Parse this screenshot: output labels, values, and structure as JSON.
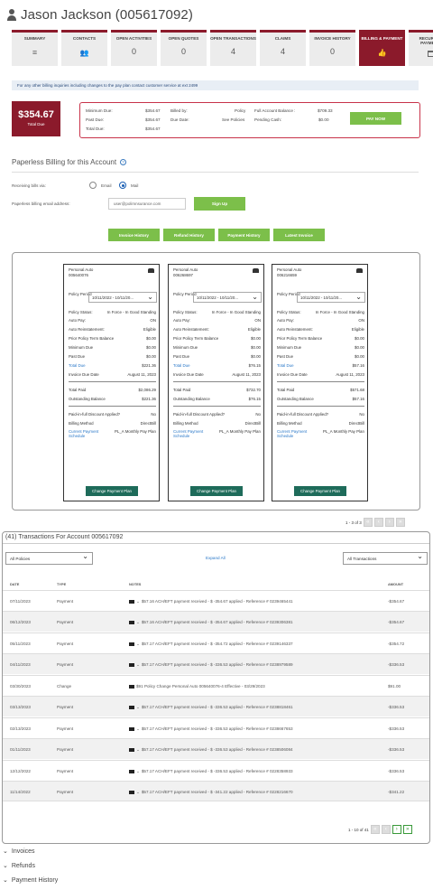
{
  "header": {
    "title": "Jason Jackson (005617092)"
  },
  "tabs": [
    {
      "label": "SUMMARY",
      "value": "",
      "icon": "menu-icon"
    },
    {
      "label": "CONTACTS",
      "value": "",
      "icon": "people-icon"
    },
    {
      "label": "OPEN ACTIVITIES",
      "value": "0"
    },
    {
      "label": "OPEN QUOTES",
      "value": "0"
    },
    {
      "label": "OPEN TRANSACTIONS",
      "value": "4"
    },
    {
      "label": "CLAIMS",
      "value": "4"
    },
    {
      "label": "INVOICE HISTORY",
      "value": "0"
    },
    {
      "label": "BILLING & PAYMENT",
      "value": "",
      "icon": "thumbs-up-icon"
    },
    {
      "label": "RECURRING PAYMENTS",
      "value": "",
      "icon": "credit-card-icon"
    }
  ],
  "info_bar": "For any other billing inquiries including changes to the pay plan contact customer service at ext 2499",
  "balance": {
    "amount": "$354.67",
    "label": "Total Due",
    "minimum_due_label": "Minimum Due:",
    "minimum_due": "$354.67",
    "past_due_label": "Past Due:",
    "past_due": "$354.67",
    "total_due_label": "Total Due:",
    "total_due": "$354.67",
    "billed_by_label": "Billed by:",
    "billed_by": "Policy",
    "due_date_label": "Due Date:",
    "due_date": "See Policies",
    "full_balance_label": "Full Account Balance :",
    "full_balance": "$709.33",
    "pending_cash_label": "Pending Cash:",
    "pending_cash": "$0.00",
    "pay_now": "PAY NOW"
  },
  "paperless": {
    "title": "Paperless Billing for this Account",
    "receiving_label": "Receiving bills via:",
    "opt_email": "Email",
    "opt_mail": "Mail",
    "email_label": "Paperless billing email address:",
    "email_value": "user@polimnsurance.com",
    "signup": "Sign Up"
  },
  "history_buttons": [
    "Invoice History",
    "Refund History",
    "Payment History",
    "Latest Invoice"
  ],
  "policies": [
    {
      "type": "Personal Auto",
      "number": "005640076",
      "policy_period_label": "Policy Period",
      "period": "10/11/2022 - 10/11/20...",
      "status_label": "Policy Status:",
      "status": "In Force - In Good Standing",
      "autopay_label": "Auto Pay:",
      "autopay": "ON",
      "reinstate_label": "Auto Reinstatement:",
      "reinstate": "Eligible",
      "prior_label": "Prior Policy Term Balance",
      "prior": "$0.00",
      "min_label": "Minimum Due",
      "min": "$0.00",
      "past_label": "Past Due",
      "past": "$0.00",
      "total_label": "Total Due",
      "total": "$221.36",
      "invdate_label": "Invoice Due Date",
      "invdate": "August 11, 2023",
      "paid_label": "Total Paid",
      "paid": "$2,086.29",
      "outst_label": "Outstanding Balance",
      "outst": "$221.36",
      "pif_label": "Paid-in-full Discount Applied?",
      "pif": "No",
      "method_label": "Billing Method",
      "method": "DirectBill",
      "schedule_label": "Current Payment Schedule",
      "schedule": "PL_A Monthly Pay Plan",
      "change_btn": "Change Payment Plan"
    },
    {
      "type": "Personal Auto",
      "number": "006268697",
      "policy_period_label": "Policy Period",
      "period": "10/11/2022 - 10/11/20...",
      "status_label": "Policy Status:",
      "status": "In Force - In Good Standing",
      "autopay_label": "Auto Pay:",
      "autopay": "ON",
      "reinstate_label": "Auto Reinstatement:",
      "reinstate": "Eligible",
      "prior_label": "Prior Policy Term Balance",
      "prior": "$0.00",
      "min_label": "Minimum Due",
      "min": "$0.00",
      "past_label": "Past Due",
      "past": "$0.00",
      "total_label": "Total Due",
      "total": "$76.15",
      "invdate_label": "Invoice Due Date",
      "invdate": "August 11, 2023",
      "paid_label": "Total Paid",
      "paid": "$732.70",
      "outst_label": "Outstanding Balance",
      "outst": "$76.15",
      "pif_label": "Paid-in-full Discount Applied?",
      "pif": "No",
      "method_label": "Billing Method",
      "method": "DirectBill",
      "schedule_label": "Current Payment Schedule",
      "schedule": "PL_A Monthly Pay Plan",
      "change_btn": "Change Payment Plan"
    },
    {
      "type": "Personal Auto",
      "number": "006216659",
      "policy_period_label": "Policy Period",
      "period": "10/11/2022 - 10/11/20...",
      "status_label": "Policy Status:",
      "status": "In Force - In Good Standing",
      "autopay_label": "Auto Pay:",
      "autopay": "ON",
      "reinstate_label": "Auto Reinstatement:",
      "reinstate": "Eligible",
      "prior_label": "Prior Policy Term Balance",
      "prior": "$0.00",
      "min_label": "Minimum Due",
      "min": "$0.00",
      "past_label": "Past Due",
      "past": "$0.00",
      "total_label": "Total Due",
      "total": "$57.16",
      "invdate_label": "Invoice Due Date",
      "invdate": "August 11, 2023",
      "paid_label": "Total Paid",
      "paid": "$571.68",
      "outst_label": "Outstanding Balance",
      "outst": "$57.16",
      "pif_label": "Paid-in-full Discount Applied?",
      "pif": "No",
      "method_label": "Billing Method",
      "method": "DirectBill",
      "schedule_label": "Current Payment Schedule",
      "schedule": "PL_A Monthly Pay Plan",
      "change_btn": "Change Payment Plan"
    }
  ],
  "policy_pager": "1 - 3 of 3",
  "transactions": {
    "title": "(41) Transactions For Account 005617092",
    "filter_policy": "All Policies",
    "expand_all": "Expand All",
    "filter_tx": "All Transactions",
    "col_date": "DATE",
    "col_type": "TYPE",
    "col_notes": "NOTES",
    "col_amount": "AMOUNT",
    "rows": [
      {
        "date": "07/11/2023",
        "type": "Payment",
        "notes": "$57.16 ACH/EFT payment received - $ -354.67 applied - Reference # 0239465441",
        "amount": "-$354.67"
      },
      {
        "date": "06/12/2023",
        "type": "Payment",
        "notes": "$57.16 ACH/EFT payment received - $ -354.67 applied - Reference # 0239306381",
        "amount": "-$354.67"
      },
      {
        "date": "05/11/2023",
        "type": "Payment",
        "notes": "$57.17 ACH/EFT payment received - $ -354.72 applied - Reference # 0239146337",
        "amount": "-$354.72"
      },
      {
        "date": "04/11/2023",
        "type": "Payment",
        "notes": "$57.17 ACH/EFT payment received - $ -336.53 applied - Reference # 0238979589",
        "amount": "-$336.53"
      },
      {
        "date": "03/30/2023",
        "type": "Change",
        "notes": "$91 Policy Change Personal Auto 005640076-4 Effective - 03/29/2023",
        "amount": "$91.00"
      },
      {
        "date": "03/13/2023",
        "type": "Payment",
        "notes": "$57.17 ACH/EFT payment received - $ -336.53 applied - Reference # 0238818461",
        "amount": "-$336.53"
      },
      {
        "date": "02/13/2023",
        "type": "Payment",
        "notes": "$57.17 ACH/EFT payment received - $ -336.53 applied - Reference # 0238667653",
        "amount": "-$336.53"
      },
      {
        "date": "01/11/2023",
        "type": "Payment",
        "notes": "$57.17 ACH/EFT payment received - $ -336.53 applied - Reference # 0238506084",
        "amount": "-$336.53"
      },
      {
        "date": "12/12/2022",
        "type": "Payment",
        "notes": "$57.17 ACH/EFT payment received - $ -336.53 applied - Reference # 0228358933",
        "amount": "-$336.53"
      },
      {
        "date": "11/14/2022",
        "type": "Payment",
        "notes": "$57.17 ACH/EFT payment received - $ -341.22 applied - Reference # 0228216670",
        "amount": "-$341.22"
      }
    ],
    "pager": "1 - 10 of 41"
  },
  "accordions": [
    "Invoices",
    "Refunds",
    "Payment History"
  ],
  "colors": {
    "brand": "#8b1a2b",
    "green": "#7cbf4a",
    "dark_green": "#1e6b5a",
    "link": "#2a78c8"
  }
}
